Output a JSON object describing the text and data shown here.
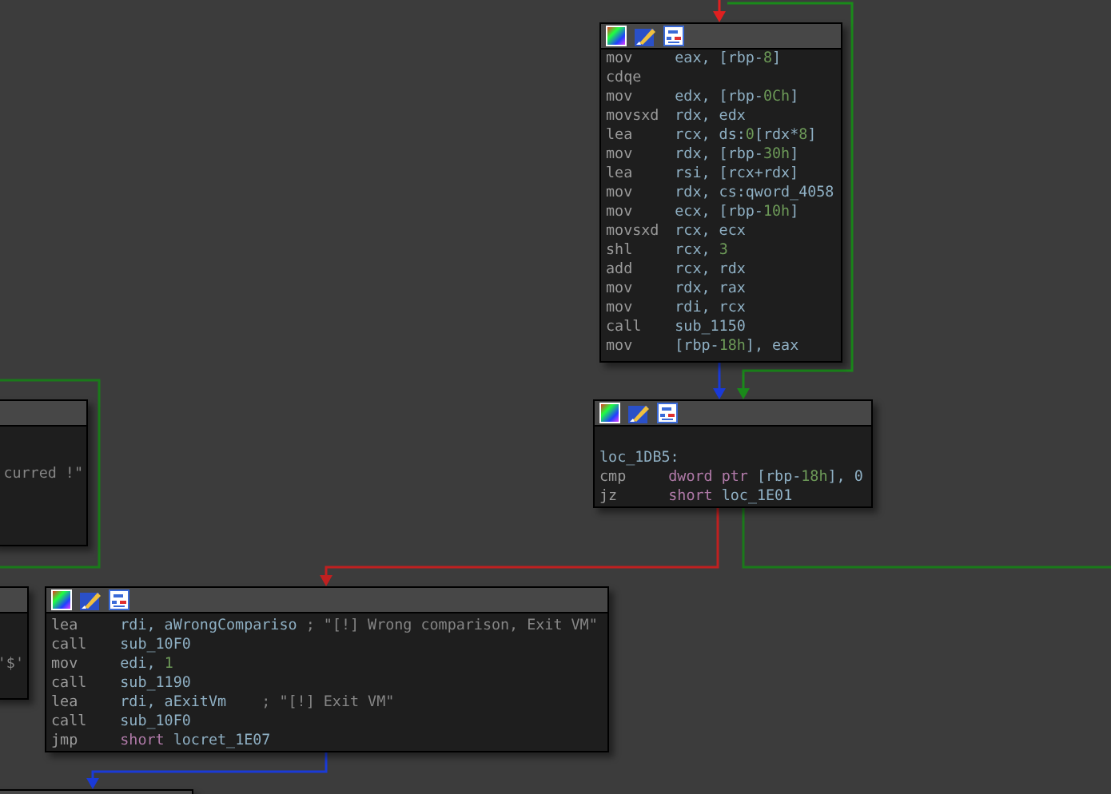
{
  "nodes": [
    {
      "header": true,
      "lines": [
        {
          "mnemonic": "mov",
          "operands": [
            {
              "kind": "reg",
              "text": "eax, [rbp-"
            },
            {
              "kind": "num",
              "text": "8"
            },
            {
              "kind": "reg",
              "text": "]"
            }
          ]
        },
        {
          "mnemonic": "cdqe"
        },
        {
          "mnemonic": "mov",
          "operands": [
            {
              "kind": "reg",
              "text": "edx, [rbp-"
            },
            {
              "kind": "num",
              "text": "0Ch"
            },
            {
              "kind": "reg",
              "text": "]"
            }
          ]
        },
        {
          "mnemonic": "movsxd",
          "operands": [
            {
              "kind": "reg",
              "text": "rdx, edx"
            }
          ]
        },
        {
          "mnemonic": "lea",
          "operands": [
            {
              "kind": "reg",
              "text": "rcx, ds:"
            },
            {
              "kind": "num",
              "text": "0"
            },
            {
              "kind": "reg",
              "text": "[rdx*"
            },
            {
              "kind": "num",
              "text": "8"
            },
            {
              "kind": "reg",
              "text": "]"
            }
          ]
        },
        {
          "mnemonic": "mov",
          "operands": [
            {
              "kind": "reg",
              "text": "rdx, [rbp-"
            },
            {
              "kind": "num",
              "text": "30h"
            },
            {
              "kind": "reg",
              "text": "]"
            }
          ]
        },
        {
          "mnemonic": "lea",
          "operands": [
            {
              "kind": "reg",
              "text": "rsi, [rcx+rdx]"
            }
          ]
        },
        {
          "mnemonic": "mov",
          "operands": [
            {
              "kind": "reg",
              "text": "rdx, cs:qword_4058"
            }
          ]
        },
        {
          "mnemonic": "mov",
          "operands": [
            {
              "kind": "reg",
              "text": "ecx, [rbp-"
            },
            {
              "kind": "num",
              "text": "10h"
            },
            {
              "kind": "reg",
              "text": "]"
            }
          ]
        },
        {
          "mnemonic": "movsxd",
          "operands": [
            {
              "kind": "reg",
              "text": "rcx, ecx"
            }
          ]
        },
        {
          "mnemonic": "shl",
          "operands": [
            {
              "kind": "reg",
              "text": "rcx, "
            },
            {
              "kind": "num",
              "text": "3"
            }
          ]
        },
        {
          "mnemonic": "add",
          "operands": [
            {
              "kind": "reg",
              "text": "rcx, rdx"
            }
          ]
        },
        {
          "mnemonic": "mov",
          "operands": [
            {
              "kind": "reg",
              "text": "rdx, rax"
            }
          ]
        },
        {
          "mnemonic": "mov",
          "operands": [
            {
              "kind": "reg",
              "text": "rdi, rcx"
            }
          ]
        },
        {
          "mnemonic": "call",
          "operands": [
            {
              "kind": "reg",
              "text": "sub_1150"
            }
          ]
        },
        {
          "mnemonic": "mov",
          "operands": [
            {
              "kind": "reg",
              "text": "[rbp-"
            },
            {
              "kind": "num",
              "text": "18h"
            },
            {
              "kind": "reg",
              "text": "], eax"
            }
          ]
        }
      ]
    },
    {
      "header": true,
      "lines": [
        {
          "operands": [
            {
              "kind": "reg",
              "text": "loc_1DB5:"
            }
          ]
        },
        {
          "mnemonic": "cmp",
          "operands": [
            {
              "kind": "kw",
              "text": "dword ptr "
            },
            {
              "kind": "reg",
              "text": "[rbp-"
            },
            {
              "kind": "num",
              "text": "18h"
            },
            {
              "kind": "reg",
              "text": "], 0"
            }
          ]
        },
        {
          "mnemonic": "jz",
          "operands": [
            {
              "kind": "kw",
              "text": "short "
            },
            {
              "kind": "reg",
              "text": "loc_1E01"
            }
          ]
        }
      ]
    },
    {
      "header": true,
      "lines": [
        {
          "mnemonic": "lea",
          "operands": [
            {
              "kind": "reg",
              "text": "rdi, aWrongCompariso "
            },
            {
              "kind": "comment",
              "text": "; \"[!] Wrong comparison, Exit VM\""
            }
          ]
        },
        {
          "mnemonic": "call",
          "operands": [
            {
              "kind": "reg",
              "text": "sub_10F0"
            }
          ]
        },
        {
          "mnemonic": "mov",
          "operands": [
            {
              "kind": "reg",
              "text": "edi, "
            },
            {
              "kind": "num",
              "text": "1"
            }
          ]
        },
        {
          "mnemonic": "call",
          "operands": [
            {
              "kind": "reg",
              "text": "sub_1190"
            }
          ]
        },
        {
          "mnemonic": "lea",
          "operands": [
            {
              "kind": "reg",
              "text": "rdi, aExitVm    "
            },
            {
              "kind": "comment",
              "text": "; \"[!] Exit VM\""
            }
          ]
        },
        {
          "mnemonic": "call",
          "operands": [
            {
              "kind": "reg",
              "text": "sub_10F0"
            }
          ]
        },
        {
          "mnemonic": "jmp",
          "operands": [
            {
              "kind": "kw",
              "text": "short "
            },
            {
              "kind": "reg",
              "text": "locret_1E07"
            }
          ]
        }
      ]
    },
    {
      "header": false,
      "lines": [
        {
          "operands": [
            {
              "kind": "comment",
              "text": "curred !\""
            }
          ]
        }
      ]
    },
    {
      "header": false,
      "lines": [
        {
          "operands": [
            {
              "kind": "comment",
              "text": "'$'"
            }
          ]
        }
      ]
    },
    {
      "header": false
    }
  ],
  "edges": [
    {
      "color": "#e02020"
    },
    {
      "color": "#1a8a1a"
    },
    {
      "color": "#1a3ad8"
    },
    {
      "color": "#c02020"
    },
    {
      "color": "#1a7a1a"
    },
    {
      "color": "#1a3ad8"
    },
    {
      "color": "#1a7a1a"
    }
  ]
}
